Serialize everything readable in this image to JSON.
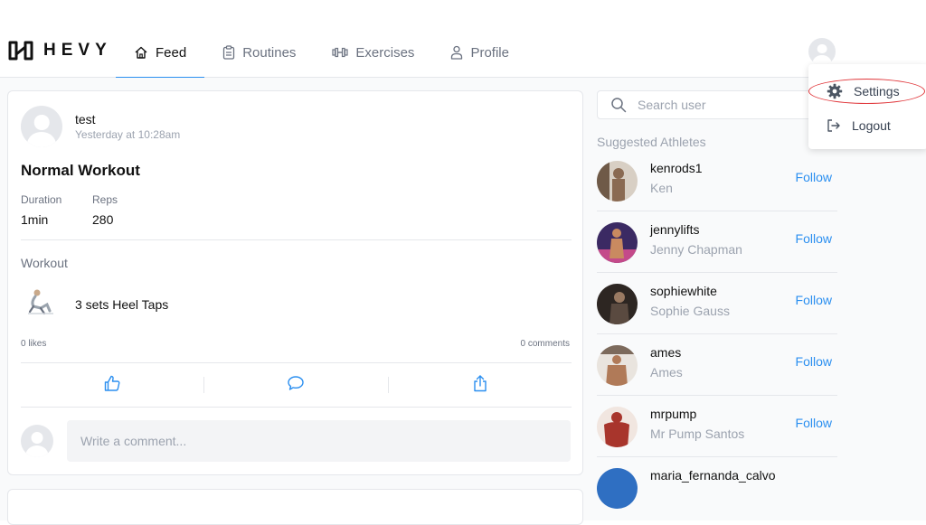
{
  "app": {
    "logo_text": "HEVY"
  },
  "nav": {
    "items": [
      {
        "label": "Feed",
        "icon": "home-icon",
        "active": true
      },
      {
        "label": "Routines",
        "icon": "clipboard-icon",
        "active": false
      },
      {
        "label": "Exercises",
        "icon": "dumbbell-icon",
        "active": false
      },
      {
        "label": "Profile",
        "icon": "user-icon",
        "active": false
      }
    ]
  },
  "dropdown": {
    "items": [
      {
        "label": "Settings",
        "icon": "gear-icon"
      },
      {
        "label": "Logout",
        "icon": "logout-icon"
      }
    ]
  },
  "post": {
    "username": "test",
    "time": "Yesterday at 10:28am",
    "title": "Normal Workout",
    "stats": [
      {
        "label": "Duration",
        "value": "1min"
      },
      {
        "label": "Reps",
        "value": "280"
      }
    ],
    "section_label": "Workout",
    "exercise": "3 sets Heel Taps",
    "likes": "0 likes",
    "comments": "0 comments",
    "comment_placeholder": "Write a comment..."
  },
  "sidebar": {
    "search_placeholder": "Search user",
    "suggest_title": "Suggested Athletes",
    "follow_label": "Follow",
    "athletes": [
      {
        "username": "kenrods1",
        "name": "Ken",
        "avatar_color": "#8a6a52"
      },
      {
        "username": "jennylifts",
        "name": "Jenny Chapman",
        "avatar_color": "#5a3a6e"
      },
      {
        "username": "sophiewhite",
        "name": "Sophie Gauss",
        "avatar_color": "#4a3a30"
      },
      {
        "username": "ames",
        "name": "Ames",
        "avatar_color": "#b07a58"
      },
      {
        "username": "mrpump",
        "name": "Mr Pump Santos",
        "avatar_color": "#a8352c"
      },
      {
        "username": "maria_fernanda_calvo",
        "name": "",
        "avatar_color": "#2f6fc2"
      }
    ]
  },
  "colors": {
    "accent": "#2b8ff0",
    "highlight_circle": "#e0363a"
  }
}
